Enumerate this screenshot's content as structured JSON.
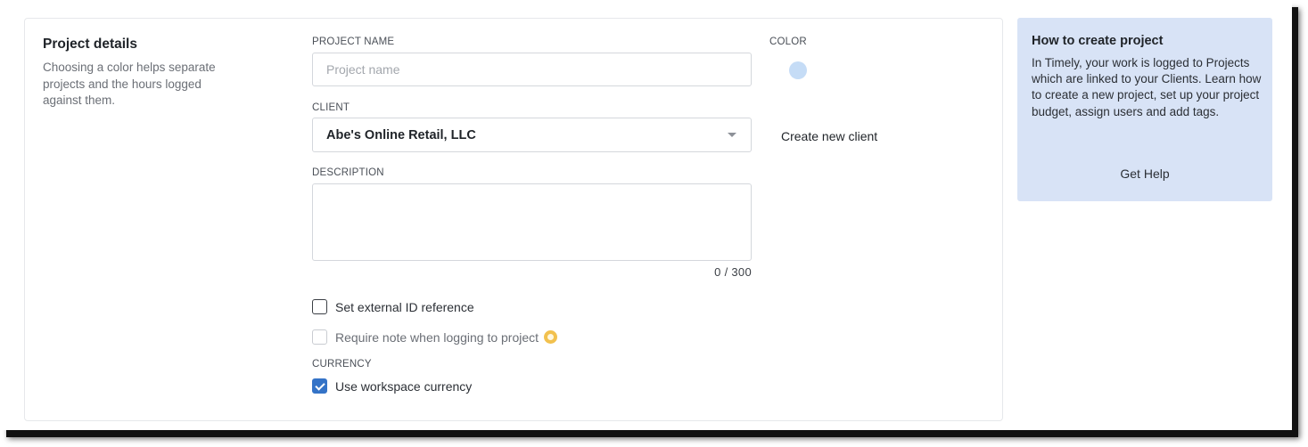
{
  "details": {
    "title": "Project details",
    "description": "Choosing a color helps separate projects and the hours logged against them."
  },
  "project_name": {
    "label": "PROJECT NAME",
    "value": "",
    "placeholder": "Project name"
  },
  "color": {
    "label": "COLOR",
    "value": "#c5dcf6"
  },
  "client": {
    "label": "CLIENT",
    "selected": "Abe's Online Retail, LLC",
    "create_link": "Create new client"
  },
  "description": {
    "label": "DESCRIPTION",
    "value": "",
    "counter": "0  /  300"
  },
  "options": {
    "external_id": {
      "label": "Set external ID reference",
      "checked": false
    },
    "require_note": {
      "label": "Require note when logging to project",
      "checked": false,
      "disabled": true,
      "badge_icon": "premium-star-icon"
    }
  },
  "currency": {
    "label": "CURRENCY",
    "use_workspace": {
      "label": "Use workspace currency",
      "checked": true
    }
  },
  "help": {
    "title": "How to create project",
    "body": "In Timely, your work is logged to Projects which are linked to your Clients. Learn how to create a new project, set up your project budget, assign users and add tags.",
    "link": "Get Help"
  },
  "colors": {
    "accent": "#3473c7",
    "help_bg": "#d8e3f6",
    "badge": "#f2c14e"
  }
}
